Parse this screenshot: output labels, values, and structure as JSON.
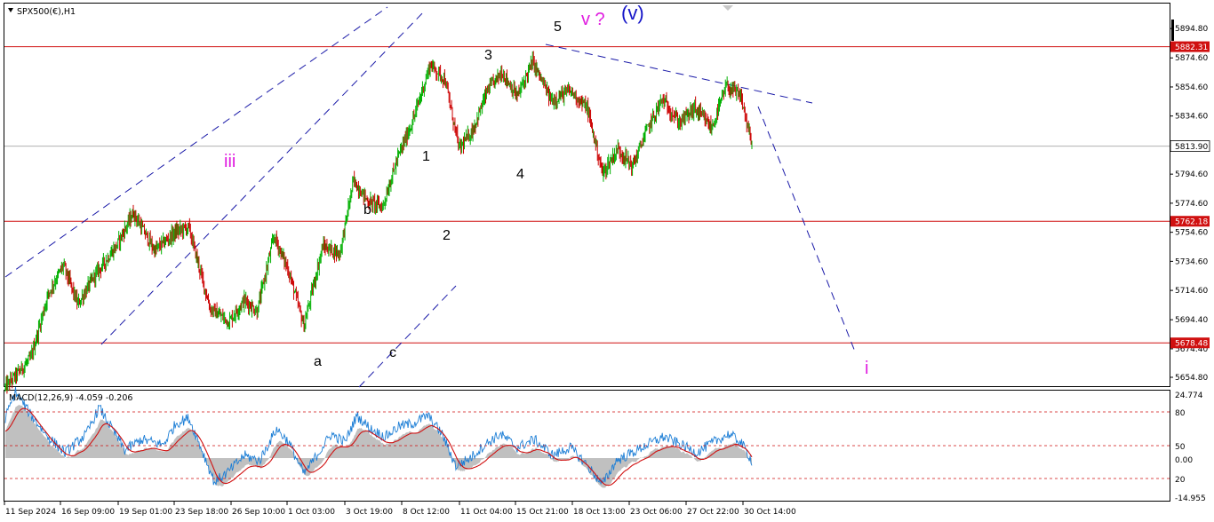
{
  "symbol_title": "SPX500(€),H1",
  "macd_title": "MACD(12,26,9) -4.059 -0.206",
  "colors": {
    "bull_candle": "#00b000",
    "bear_candle": "#cc0000",
    "level_line": "#d01010",
    "trend_line": "#1a1aa8",
    "wave_magenta": "#e01ce0",
    "wave_blue": "#1515c8",
    "macd_hist": "#c0c0c0",
    "macd_line": "#1e7fd6",
    "signal_line": "#d01010",
    "grid": "#c8c8c8",
    "last_price_line": "#b0b0b0"
  },
  "chart_data": [
    {
      "type": "candlestick",
      "title": "SPX500(€),H1",
      "y_axis_ticks": [
        "5894.80",
        "5874.60",
        "5854.60",
        "5834.60",
        "5794.60",
        "5774.60",
        "5754.60",
        "5734.60",
        "5714.60",
        "5694.40",
        "5674.40",
        "5654.80"
      ],
      "x_axis_ticks": [
        "11 Sep 2024",
        "16 Sep 09:00",
        "19 Sep 01:00",
        "23 Sep 18:00",
        "26 Sep 10:00",
        "1 Oct 03:00",
        "3 Oct 19:00",
        "8 Oct 12:00",
        "11 Oct 04:00",
        "15 Oct 21:00",
        "18 Oct 13:00",
        "23 Oct 06:00",
        "27 Oct 22:00",
        "30 Oct 14:00"
      ],
      "ylim": [
        5650,
        5912
      ],
      "price_levels": [
        {
          "value": 5882.31,
          "label": "5882.31",
          "style": "red-tag"
        },
        {
          "value": 5813.9,
          "label": "5813.90",
          "style": "last-price"
        },
        {
          "value": 5762.18,
          "label": "5762.18",
          "style": "red-tag"
        },
        {
          "value": 5678.48,
          "label": "5678.48",
          "style": "red-tag"
        }
      ],
      "price_path": [
        {
          "bar": 0,
          "price": 5648
        },
        {
          "bar": 30,
          "price": 5668
        },
        {
          "bar": 50,
          "price": 5712
        },
        {
          "bar": 68,
          "price": 5732
        },
        {
          "bar": 85,
          "price": 5705
        },
        {
          "bar": 105,
          "price": 5725
        },
        {
          "bar": 130,
          "price": 5745
        },
        {
          "bar": 150,
          "price": 5768
        },
        {
          "bar": 175,
          "price": 5742
        },
        {
          "bar": 200,
          "price": 5755
        },
        {
          "bar": 215,
          "price": 5758
        },
        {
          "bar": 240,
          "price": 5702
        },
        {
          "bar": 262,
          "price": 5693
        },
        {
          "bar": 280,
          "price": 5708
        },
        {
          "bar": 295,
          "price": 5700
        },
        {
          "bar": 315,
          "price": 5752
        },
        {
          "bar": 332,
          "price": 5728
        },
        {
          "bar": 350,
          "price": 5690
        },
        {
          "bar": 372,
          "price": 5745
        },
        {
          "bar": 392,
          "price": 5740
        },
        {
          "bar": 408,
          "price": 5790
        },
        {
          "bar": 425,
          "price": 5776
        },
        {
          "bar": 442,
          "price": 5772
        },
        {
          "bar": 460,
          "price": 5806
        },
        {
          "bar": 478,
          "price": 5832
        },
        {
          "bar": 498,
          "price": 5870
        },
        {
          "bar": 515,
          "price": 5860
        },
        {
          "bar": 532,
          "price": 5812
        },
        {
          "bar": 548,
          "price": 5825
        },
        {
          "bar": 565,
          "price": 5852
        },
        {
          "bar": 582,
          "price": 5865
        },
        {
          "bar": 600,
          "price": 5848
        },
        {
          "bar": 618,
          "price": 5872
        },
        {
          "bar": 640,
          "price": 5845
        },
        {
          "bar": 662,
          "price": 5852
        },
        {
          "bar": 682,
          "price": 5840
        },
        {
          "bar": 700,
          "price": 5795
        },
        {
          "bar": 718,
          "price": 5812
        },
        {
          "bar": 735,
          "price": 5800
        },
        {
          "bar": 752,
          "price": 5825
        },
        {
          "bar": 770,
          "price": 5846
        },
        {
          "bar": 790,
          "price": 5830
        },
        {
          "bar": 808,
          "price": 5840
        },
        {
          "bar": 828,
          "price": 5826
        },
        {
          "bar": 845,
          "price": 5855
        },
        {
          "bar": 862,
          "price": 5848
        },
        {
          "bar": 875,
          "price": 5814
        }
      ],
      "annotations": [
        {
          "text": "iii",
          "color": "magenta"
        },
        {
          "text": "a",
          "color": "black"
        },
        {
          "text": "b",
          "color": "black"
        },
        {
          "text": "c",
          "color": "black"
        },
        {
          "text": "1",
          "color": "black"
        },
        {
          "text": "2",
          "color": "black"
        },
        {
          "text": "3",
          "color": "black"
        },
        {
          "text": "4",
          "color": "black"
        },
        {
          "text": "5",
          "color": "black"
        },
        {
          "text": "v ?",
          "color": "magenta"
        },
        {
          "text": "(v)",
          "color": "blue"
        },
        {
          "text": "i",
          "color": "magenta"
        }
      ]
    },
    {
      "type": "macd",
      "title": "MACD(12,26,9) -4.059 -0.206",
      "y_axis_ticks": [
        "24.774",
        "80",
        "50",
        "0.00",
        "20",
        "-14.955"
      ],
      "levels_dashed": [
        "80",
        "50",
        "20"
      ],
      "macd_path": [
        {
          "bar": 0,
          "value": 12
        },
        {
          "bar": 12,
          "value": 22
        },
        {
          "bar": 28,
          "value": 14
        },
        {
          "bar": 50,
          "value": 5
        },
        {
          "bar": 70,
          "value": -1
        },
        {
          "bar": 95,
          "value": 6
        },
        {
          "bar": 110,
          "value": 16
        },
        {
          "bar": 125,
          "value": 8
        },
        {
          "bar": 140,
          "value": 0
        },
        {
          "bar": 160,
          "value": 4
        },
        {
          "bar": 185,
          "value": 2
        },
        {
          "bar": 200,
          "value": 10
        },
        {
          "bar": 215,
          "value": 12
        },
        {
          "bar": 228,
          "value": 2
        },
        {
          "bar": 245,
          "value": -12
        },
        {
          "bar": 262,
          "value": -8
        },
        {
          "bar": 280,
          "value": -2
        },
        {
          "bar": 298,
          "value": -4
        },
        {
          "bar": 318,
          "value": 8
        },
        {
          "bar": 332,
          "value": 3
        },
        {
          "bar": 350,
          "value": -9
        },
        {
          "bar": 365,
          "value": -2
        },
        {
          "bar": 382,
          "value": 6
        },
        {
          "bar": 398,
          "value": 3
        },
        {
          "bar": 412,
          "value": 13
        },
        {
          "bar": 428,
          "value": 8
        },
        {
          "bar": 445,
          "value": 5
        },
        {
          "bar": 462,
          "value": 9
        },
        {
          "bar": 478,
          "value": 10
        },
        {
          "bar": 495,
          "value": 13
        },
        {
          "bar": 512,
          "value": 6
        },
        {
          "bar": 528,
          "value": -6
        },
        {
          "bar": 545,
          "value": -3
        },
        {
          "bar": 562,
          "value": 2
        },
        {
          "bar": 580,
          "value": 6
        },
        {
          "bar": 600,
          "value": 1
        },
        {
          "bar": 620,
          "value": 4
        },
        {
          "bar": 642,
          "value": -2
        },
        {
          "bar": 662,
          "value": 1
        },
        {
          "bar": 680,
          "value": -5
        },
        {
          "bar": 700,
          "value": -13
        },
        {
          "bar": 716,
          "value": -4
        },
        {
          "bar": 735,
          "value": -1
        },
        {
          "bar": 752,
          "value": 2
        },
        {
          "bar": 772,
          "value": 5
        },
        {
          "bar": 792,
          "value": 2
        },
        {
          "bar": 810,
          "value": -1
        },
        {
          "bar": 830,
          "value": 3
        },
        {
          "bar": 848,
          "value": 6
        },
        {
          "bar": 862,
          "value": 3
        },
        {
          "bar": 875,
          "value": -4
        }
      ]
    }
  ]
}
